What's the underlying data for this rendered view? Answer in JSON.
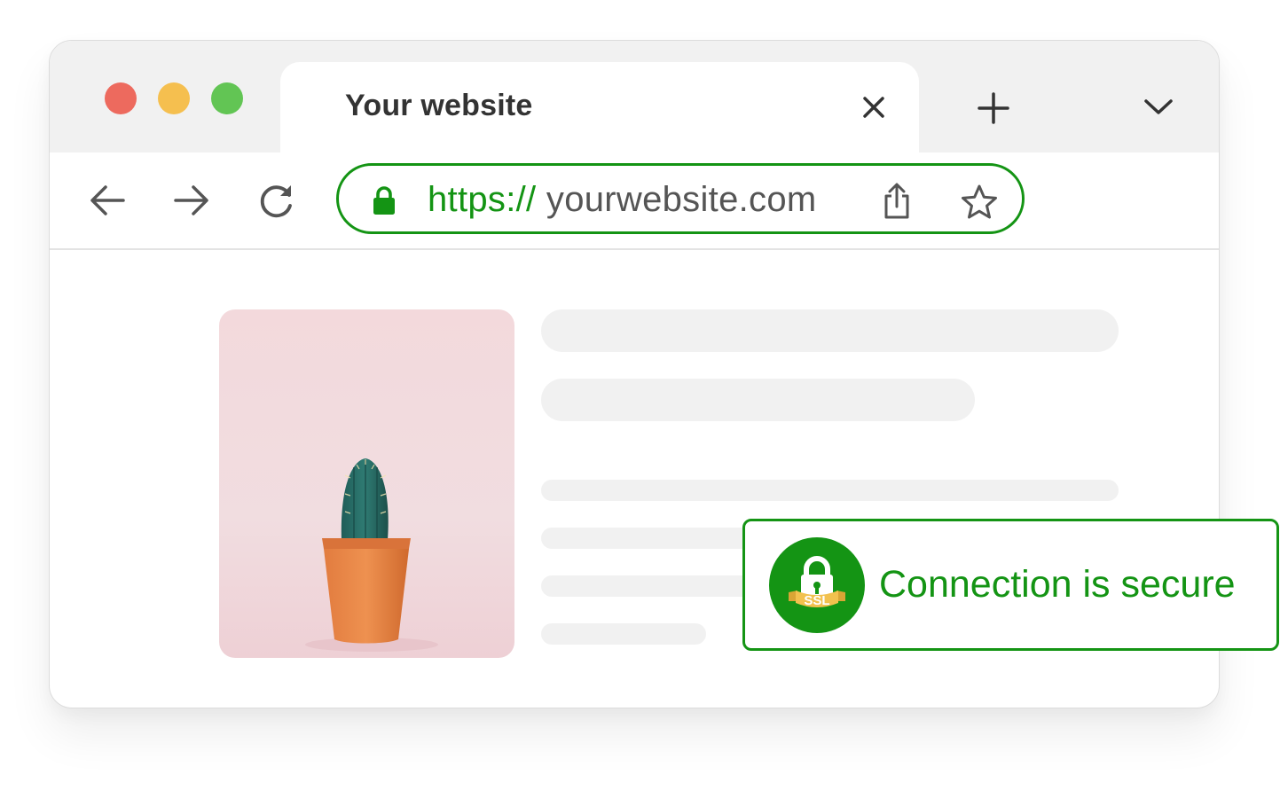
{
  "tab": {
    "title": "Your website",
    "close_icon": "close-icon",
    "new_tab_icon": "plus-icon",
    "dropdown_icon": "chevron-down-icon"
  },
  "window_controls": [
    "close",
    "minimize",
    "zoom"
  ],
  "toolbar": {
    "back_icon": "arrow-left-icon",
    "forward_icon": "arrow-right-icon",
    "reload_icon": "reload-icon"
  },
  "address_bar": {
    "scheme": "https://",
    "host": "yourwebsite.com",
    "lock_icon": "lock-icon",
    "share_icon": "share-icon",
    "bookmark_icon": "star-icon"
  },
  "page": {
    "image_subject": "cactus-in-pot",
    "placeholder_lines": 6
  },
  "security_badge": {
    "badge_text": "SSL",
    "message": "Connection is secure"
  },
  "colors": {
    "secure_green": "#149414",
    "titlebar": "#f1f1f1",
    "skeleton": "#f1f1f1",
    "dot_red": "#ed6a5e",
    "dot_yellow": "#f5bf4f",
    "dot_green": "#62c554",
    "ribbon": "#f2c14e"
  }
}
